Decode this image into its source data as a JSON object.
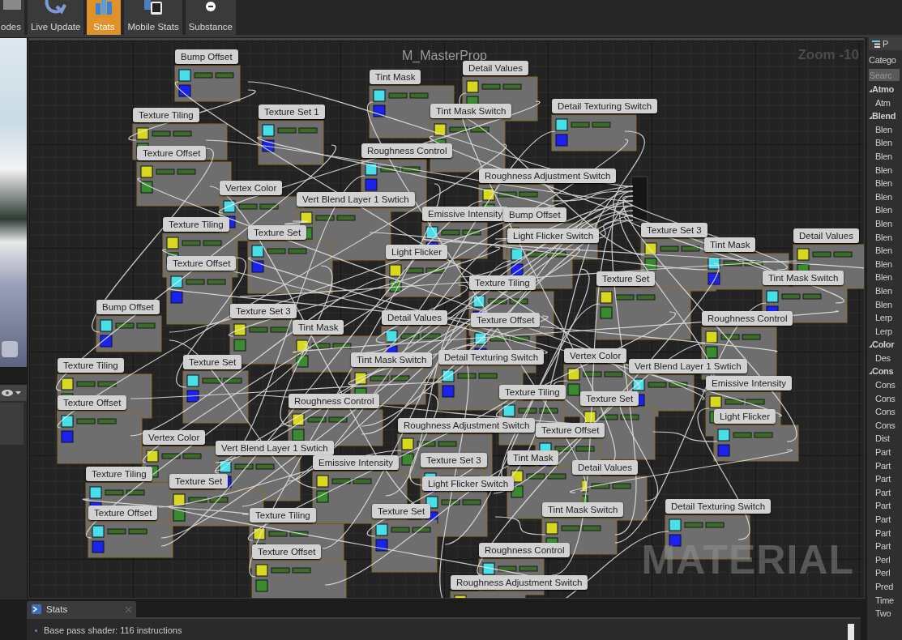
{
  "toolbar": {
    "buttons": [
      {
        "label": "odes",
        "selected": false,
        "kind": "nodes"
      },
      {
        "label": "Live Update",
        "selected": false,
        "kind": "live"
      },
      {
        "label": "Stats",
        "selected": true,
        "kind": "stats"
      },
      {
        "label": "Mobile Stats",
        "selected": false,
        "kind": "mobile"
      },
      {
        "label": "Substance",
        "selected": false,
        "kind": "substance"
      }
    ]
  },
  "graph": {
    "title": "M_MasterProp",
    "zoom": "Zoom -10",
    "watermark": "MATERIAL",
    "comments": [
      {
        "label": "Bump Offset"
      },
      {
        "label": "Detail Values"
      },
      {
        "label": "Tint Mask"
      },
      {
        "label": "Texture Tiling"
      },
      {
        "label": "Texture Set 1"
      },
      {
        "label": "Tint Mask Switch"
      },
      {
        "label": "Detail Texturing Switch"
      },
      {
        "label": "Texture Offset"
      },
      {
        "label": "Roughness Control"
      },
      {
        "label": "Roughness Adjustment Switch"
      },
      {
        "label": "Vertex Color"
      },
      {
        "label": "Vert Blend Layer 1 Swtich"
      },
      {
        "label": "Emissive Intensity"
      },
      {
        "label": "Texture Tiling"
      },
      {
        "label": "Texture Set"
      },
      {
        "label": "Bump Offset"
      },
      {
        "label": "Light Flicker Switch"
      },
      {
        "label": "Texture Set 3"
      },
      {
        "label": "Tint Mask"
      },
      {
        "label": "Detail Values"
      },
      {
        "label": "Texture Offset"
      },
      {
        "label": "Light Flicker"
      },
      {
        "label": "Texture Tiling"
      },
      {
        "label": "Texture Set"
      },
      {
        "label": "Bump Offset"
      },
      {
        "label": "Texture Set 3"
      },
      {
        "label": "Detail Values"
      },
      {
        "label": "Tint Mask"
      },
      {
        "label": "Texture Offset"
      },
      {
        "label": "Roughness Control"
      },
      {
        "label": "Tint Mask Switch"
      },
      {
        "label": "Texture Tiling"
      },
      {
        "label": "Texture Set"
      },
      {
        "label": "Tint Mask Switch"
      },
      {
        "label": "Detail Texturing Switch"
      },
      {
        "label": "Vertex Color"
      },
      {
        "label": "Vert Blend Layer 1 Swtich"
      },
      {
        "label": "Emissive Intensity"
      },
      {
        "label": "Texture Offset"
      },
      {
        "label": "Roughness Control"
      },
      {
        "label": "Texture Tiling"
      },
      {
        "label": "Texture Set"
      },
      {
        "label": "Light Flicker"
      },
      {
        "label": "Roughness Adjustment Switch"
      },
      {
        "label": "Texture Offset"
      },
      {
        "label": "Vertex Color"
      },
      {
        "label": "Vert Blend Layer 1 Swtich"
      },
      {
        "label": "Emissive Intensity"
      },
      {
        "label": "Texture Set 3"
      },
      {
        "label": "Detail Values"
      },
      {
        "label": "Texture Tiling"
      },
      {
        "label": "Texture Set"
      },
      {
        "label": "Light Flicker Switch"
      },
      {
        "label": "Tint Mask"
      },
      {
        "label": "Texture Offset"
      },
      {
        "label": "Texture Tiling"
      },
      {
        "label": "Texture Set"
      },
      {
        "label": "Tint Mask Switch"
      },
      {
        "label": "Detail Texturing Switch"
      },
      {
        "label": "Texture Offset"
      },
      {
        "label": "Roughness Control"
      },
      {
        "label": "Roughness Adjustment Switch"
      }
    ]
  },
  "stats_panel": {
    "tab": "Stats",
    "lines": [
      "Base pass shader: 116 instructions"
    ]
  },
  "palette": {
    "tab": "P",
    "category_label": "Catego",
    "search_placeholder": "Searc",
    "items": [
      {
        "label": "Atmo",
        "kind": "header",
        "expanded": true
      },
      {
        "label": "Atm",
        "kind": "item"
      },
      {
        "label": "Blend",
        "kind": "header",
        "expanded": true
      },
      {
        "label": "Blen",
        "kind": "item"
      },
      {
        "label": "Blen",
        "kind": "item"
      },
      {
        "label": "Blen",
        "kind": "item"
      },
      {
        "label": "Blen",
        "kind": "item"
      },
      {
        "label": "Blen",
        "kind": "item"
      },
      {
        "label": "Blen",
        "kind": "item"
      },
      {
        "label": "Blen",
        "kind": "item"
      },
      {
        "label": "Blen",
        "kind": "item"
      },
      {
        "label": "Blen",
        "kind": "item"
      },
      {
        "label": "Blen",
        "kind": "item"
      },
      {
        "label": "Blen",
        "kind": "item"
      },
      {
        "label": "Blen",
        "kind": "item"
      },
      {
        "label": "Blen",
        "kind": "item"
      },
      {
        "label": "Blen",
        "kind": "item"
      },
      {
        "label": "Lerp",
        "kind": "item"
      },
      {
        "label": "Lerp",
        "kind": "item"
      },
      {
        "label": "Color",
        "kind": "header",
        "expanded": true
      },
      {
        "label": "Des",
        "kind": "item"
      },
      {
        "label": "Cons",
        "kind": "header",
        "expanded": true
      },
      {
        "label": "Cons",
        "kind": "item"
      },
      {
        "label": "Cons",
        "kind": "item"
      },
      {
        "label": "Cons",
        "kind": "item"
      },
      {
        "label": "Cons",
        "kind": "item"
      },
      {
        "label": "Dist",
        "kind": "item"
      },
      {
        "label": "Part",
        "kind": "item"
      },
      {
        "label": "Part",
        "kind": "item"
      },
      {
        "label": "Part",
        "kind": "item"
      },
      {
        "label": "Part",
        "kind": "item"
      },
      {
        "label": "Part",
        "kind": "item"
      },
      {
        "label": "Part",
        "kind": "item"
      },
      {
        "label": "Part",
        "kind": "item"
      },
      {
        "label": "Part",
        "kind": "item"
      },
      {
        "label": "Perl",
        "kind": "item"
      },
      {
        "label": "Perl",
        "kind": "item"
      },
      {
        "label": "Pred",
        "kind": "item"
      },
      {
        "label": "Time",
        "kind": "item"
      },
      {
        "label": "Two",
        "kind": "item"
      }
    ]
  }
}
